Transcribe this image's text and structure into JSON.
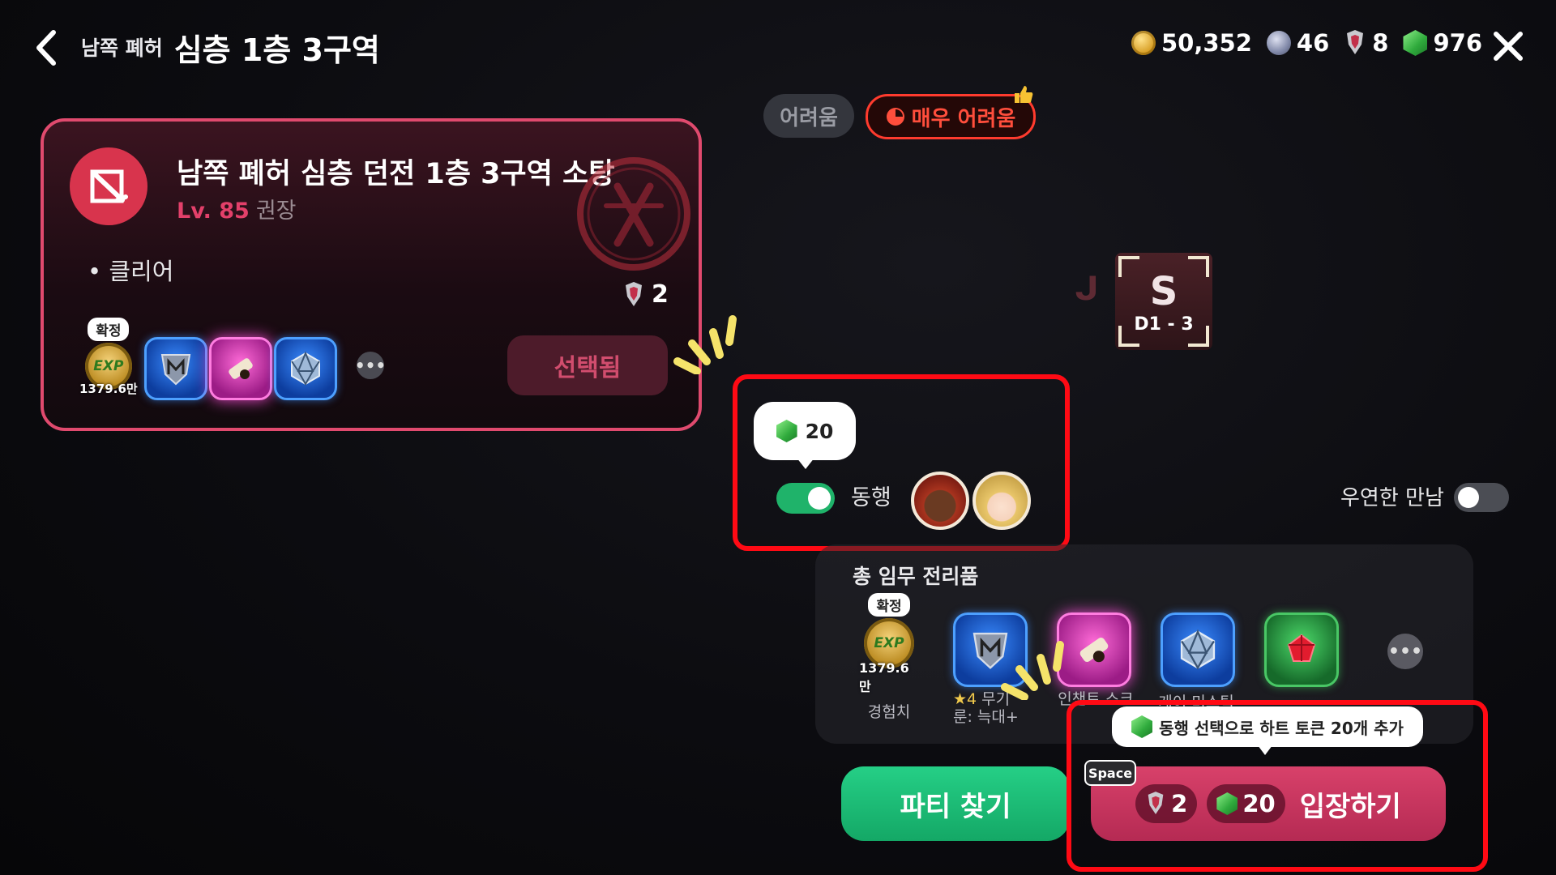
{
  "header": {
    "back_icon": "chevron-left-icon",
    "subtitle": "남쪽 폐허",
    "title": "심층 1층 3구역",
    "close_icon": "close-icon"
  },
  "currency": {
    "gold": "50,352",
    "orb": "46",
    "key": "8",
    "heart_token": "976"
  },
  "difficulty": {
    "normal": "어려움",
    "very_hard": "매우 어려움",
    "selected": "매우 어려움"
  },
  "quest": {
    "title": "남쪽 폐허 심층 던전 1층 3구역 소탕",
    "level_text": "Lv. 85",
    "level_suffix": "권장",
    "objective": "클리어",
    "key_cost": "2",
    "selected_label": "선택됨",
    "rewards": {
      "fixed_tag": "확정",
      "exp_amount": "1379.6만",
      "more": "•••"
    }
  },
  "companion": {
    "cost": "20",
    "label": "동행",
    "enabled": true
  },
  "encounter": {
    "label": "우연한 만남",
    "enabled": false
  },
  "map": {
    "glyph": "S",
    "tile_label": "D1 - 3"
  },
  "reward_panel": {
    "title": "총 임무 전리품",
    "fixed_tag": "확정",
    "exp_amount": "1379.6만",
    "exp_caption": "경험치",
    "item2_caption_star": "★4",
    "item2_caption_a": "무기",
    "item2_caption_b": "룬: 늑대+",
    "item3_caption": "인챈트 스크롤: 독스헌터",
    "item4_caption": "게이 미스틱",
    "more": "•••"
  },
  "actions": {
    "party_label": "파티 찾기",
    "enter_label": "입장하기",
    "enter_key_cost": "2",
    "enter_heart_cost": "20",
    "shortcut": "Space",
    "tooltip": "동행 선택으로 하트 토큰 20개 추가"
  },
  "colors": {
    "accent_pink": "#e04a6e",
    "toggle_green": "#1fb36a",
    "highlight_red": "#ff0a14",
    "party_green": "#14a866"
  }
}
